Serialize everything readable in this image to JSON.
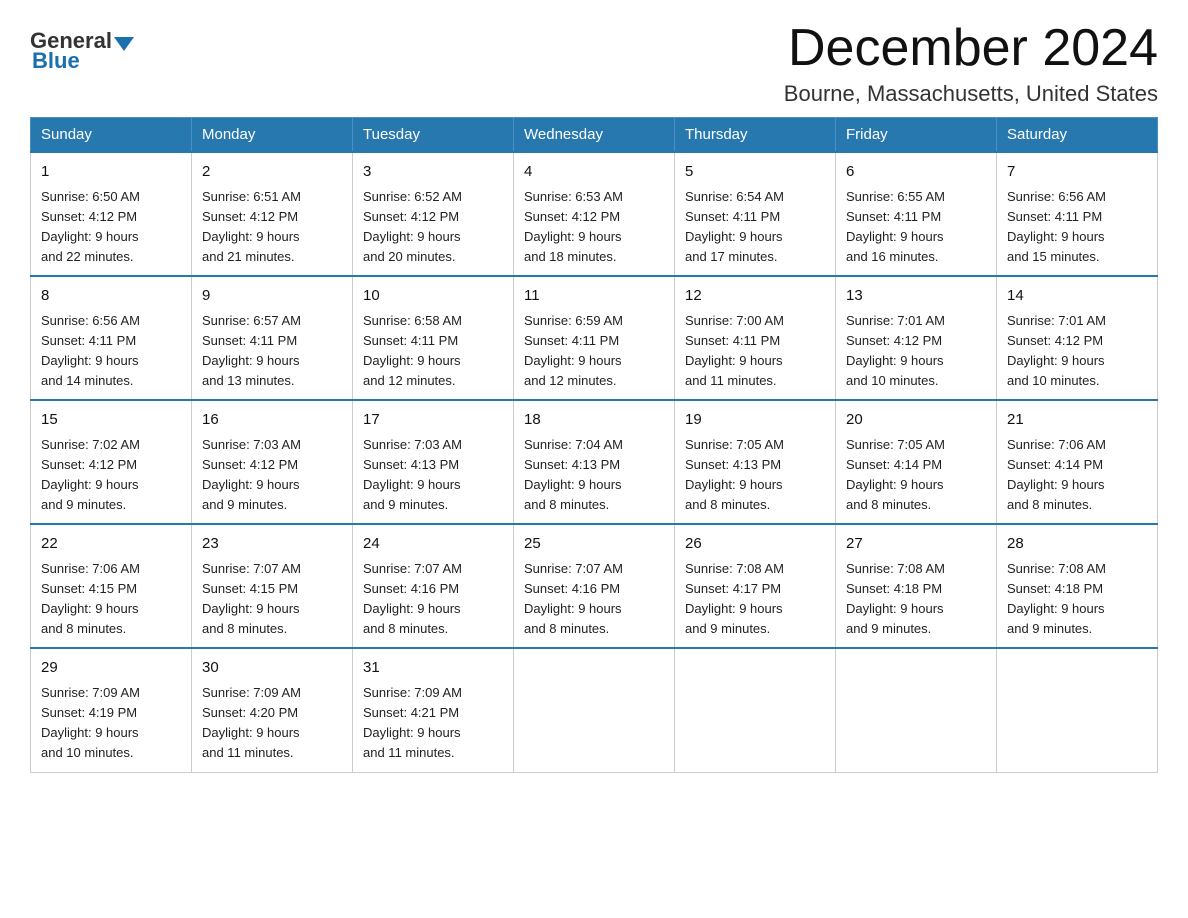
{
  "logo": {
    "general": "General",
    "blue": "Blue"
  },
  "header": {
    "title": "December 2024",
    "subtitle": "Bourne, Massachusetts, United States"
  },
  "days_of_week": [
    "Sunday",
    "Monday",
    "Tuesday",
    "Wednesday",
    "Thursday",
    "Friday",
    "Saturday"
  ],
  "weeks": [
    [
      {
        "day": "1",
        "sunrise": "6:50 AM",
        "sunset": "4:12 PM",
        "daylight": "9 hours and 22 minutes."
      },
      {
        "day": "2",
        "sunrise": "6:51 AM",
        "sunset": "4:12 PM",
        "daylight": "9 hours and 21 minutes."
      },
      {
        "day": "3",
        "sunrise": "6:52 AM",
        "sunset": "4:12 PM",
        "daylight": "9 hours and 20 minutes."
      },
      {
        "day": "4",
        "sunrise": "6:53 AM",
        "sunset": "4:12 PM",
        "daylight": "9 hours and 18 minutes."
      },
      {
        "day": "5",
        "sunrise": "6:54 AM",
        "sunset": "4:11 PM",
        "daylight": "9 hours and 17 minutes."
      },
      {
        "day": "6",
        "sunrise": "6:55 AM",
        "sunset": "4:11 PM",
        "daylight": "9 hours and 16 minutes."
      },
      {
        "day": "7",
        "sunrise": "6:56 AM",
        "sunset": "4:11 PM",
        "daylight": "9 hours and 15 minutes."
      }
    ],
    [
      {
        "day": "8",
        "sunrise": "6:56 AM",
        "sunset": "4:11 PM",
        "daylight": "9 hours and 14 minutes."
      },
      {
        "day": "9",
        "sunrise": "6:57 AM",
        "sunset": "4:11 PM",
        "daylight": "9 hours and 13 minutes."
      },
      {
        "day": "10",
        "sunrise": "6:58 AM",
        "sunset": "4:11 PM",
        "daylight": "9 hours and 12 minutes."
      },
      {
        "day": "11",
        "sunrise": "6:59 AM",
        "sunset": "4:11 PM",
        "daylight": "9 hours and 12 minutes."
      },
      {
        "day": "12",
        "sunrise": "7:00 AM",
        "sunset": "4:11 PM",
        "daylight": "9 hours and 11 minutes."
      },
      {
        "day": "13",
        "sunrise": "7:01 AM",
        "sunset": "4:12 PM",
        "daylight": "9 hours and 10 minutes."
      },
      {
        "day": "14",
        "sunrise": "7:01 AM",
        "sunset": "4:12 PM",
        "daylight": "9 hours and 10 minutes."
      }
    ],
    [
      {
        "day": "15",
        "sunrise": "7:02 AM",
        "sunset": "4:12 PM",
        "daylight": "9 hours and 9 minutes."
      },
      {
        "day": "16",
        "sunrise": "7:03 AM",
        "sunset": "4:12 PM",
        "daylight": "9 hours and 9 minutes."
      },
      {
        "day": "17",
        "sunrise": "7:03 AM",
        "sunset": "4:13 PM",
        "daylight": "9 hours and 9 minutes."
      },
      {
        "day": "18",
        "sunrise": "7:04 AM",
        "sunset": "4:13 PM",
        "daylight": "9 hours and 8 minutes."
      },
      {
        "day": "19",
        "sunrise": "7:05 AM",
        "sunset": "4:13 PM",
        "daylight": "9 hours and 8 minutes."
      },
      {
        "day": "20",
        "sunrise": "7:05 AM",
        "sunset": "4:14 PM",
        "daylight": "9 hours and 8 minutes."
      },
      {
        "day": "21",
        "sunrise": "7:06 AM",
        "sunset": "4:14 PM",
        "daylight": "9 hours and 8 minutes."
      }
    ],
    [
      {
        "day": "22",
        "sunrise": "7:06 AM",
        "sunset": "4:15 PM",
        "daylight": "9 hours and 8 minutes."
      },
      {
        "day": "23",
        "sunrise": "7:07 AM",
        "sunset": "4:15 PM",
        "daylight": "9 hours and 8 minutes."
      },
      {
        "day": "24",
        "sunrise": "7:07 AM",
        "sunset": "4:16 PM",
        "daylight": "9 hours and 8 minutes."
      },
      {
        "day": "25",
        "sunrise": "7:07 AM",
        "sunset": "4:16 PM",
        "daylight": "9 hours and 8 minutes."
      },
      {
        "day": "26",
        "sunrise": "7:08 AM",
        "sunset": "4:17 PM",
        "daylight": "9 hours and 9 minutes."
      },
      {
        "day": "27",
        "sunrise": "7:08 AM",
        "sunset": "4:18 PM",
        "daylight": "9 hours and 9 minutes."
      },
      {
        "day": "28",
        "sunrise": "7:08 AM",
        "sunset": "4:18 PM",
        "daylight": "9 hours and 9 minutes."
      }
    ],
    [
      {
        "day": "29",
        "sunrise": "7:09 AM",
        "sunset": "4:19 PM",
        "daylight": "9 hours and 10 minutes."
      },
      {
        "day": "30",
        "sunrise": "7:09 AM",
        "sunset": "4:20 PM",
        "daylight": "9 hours and 11 minutes."
      },
      {
        "day": "31",
        "sunrise": "7:09 AM",
        "sunset": "4:21 PM",
        "daylight": "9 hours and 11 minutes."
      },
      null,
      null,
      null,
      null
    ]
  ],
  "labels": {
    "sunrise": "Sunrise: ",
    "sunset": "Sunset: ",
    "daylight": "Daylight: "
  }
}
